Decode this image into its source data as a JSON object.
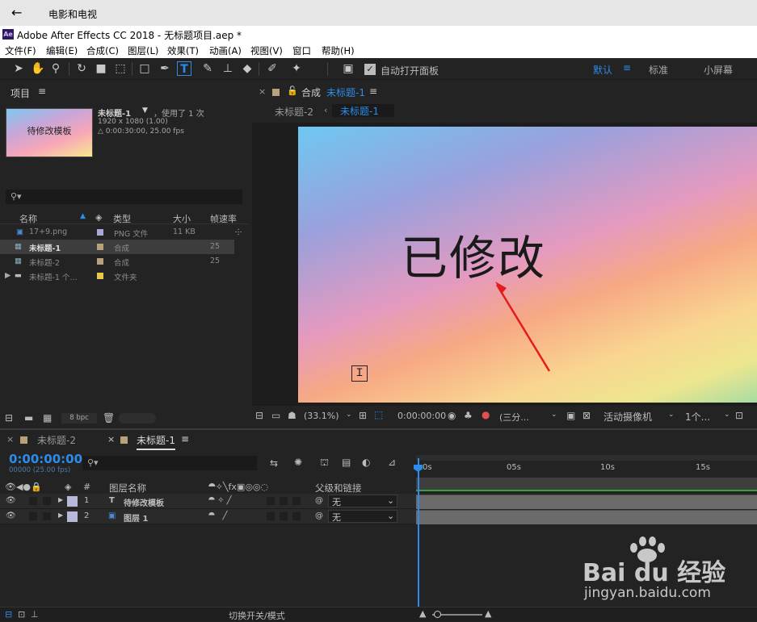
{
  "host": {
    "back": "←",
    "title": "电影和电视"
  },
  "ae": {
    "logo": "Ae",
    "title": "Adobe After Effects CC 2018 - 无标题项目.aep *"
  },
  "menu": [
    "文件(F)",
    "编辑(E)",
    "合成(C)",
    "图层(L)",
    "效果(T)",
    "动画(A)",
    "视图(V)",
    "窗口",
    "帮助(H)"
  ],
  "toolbar": {
    "auto_open_label": "自动打开面板",
    "workspaces": [
      "默认",
      "标准",
      "小屏幕"
    ],
    "menu_icon": "≡"
  },
  "project": {
    "title": "项目",
    "comp_name": "未标题-1",
    "used": "，使用了 1 次",
    "size": "1920 x 1080 (1.00)",
    "duration": "△ 0:00:30:00, 25.00 fps",
    "thumb_text": "待修改模板",
    "search_placeholder": "",
    "columns": [
      "名称",
      "类型",
      "大小",
      "帧速率"
    ],
    "rows": [
      {
        "name": "17+9.png",
        "type": "PNG 文件",
        "size": "11 KB",
        "fps": "",
        "color": "#a8a8d8"
      },
      {
        "name": "未标题-1",
        "type": "合成",
        "size": "",
        "fps": "25",
        "color": "#b8a27c"
      },
      {
        "name": "未标题-2",
        "type": "合成",
        "size": "",
        "fps": "25",
        "color": "#b8a27c"
      },
      {
        "name": "未标题-1 个...",
        "type": "文件夹",
        "size": "",
        "fps": "",
        "color": "#e6c84a"
      }
    ],
    "bpc": "8 bpc"
  },
  "comp": {
    "tab_label": "合成",
    "tab_name": "未标题-1",
    "breadcrumb_prev": "未标题-2",
    "breadcrumb_current": "未标题-1",
    "viewer_text": "已修改",
    "zoom": "(33.1%)",
    "timecode": "0:00:00:00",
    "resolution": "(三分...",
    "camera": "活动摄像机",
    "views": "1个..."
  },
  "timeline": {
    "tabs": [
      "未标题-2",
      "未标题-1"
    ],
    "timecode": "0:00:00:00",
    "timecode_sub": "00000 (25.00 fps)",
    "col_layer_name": "图层名称",
    "col_parent": "父级和链接",
    "col_num": "#",
    "ruler": [
      "0s",
      "05s",
      "10s",
      "15s"
    ],
    "layers": [
      {
        "num": "1",
        "type_icon": "T",
        "name": "待修改模板",
        "parent": "无",
        "color": "#b8b8d8"
      },
      {
        "num": "2",
        "type_icon": "img",
        "name": "图层 1",
        "parent": "无",
        "color": "#b8b8d8"
      }
    ],
    "footer": "切换开关/模式"
  },
  "watermark": {
    "brand": "Bai du 经验",
    "url": "jingyan.baidu.com"
  }
}
